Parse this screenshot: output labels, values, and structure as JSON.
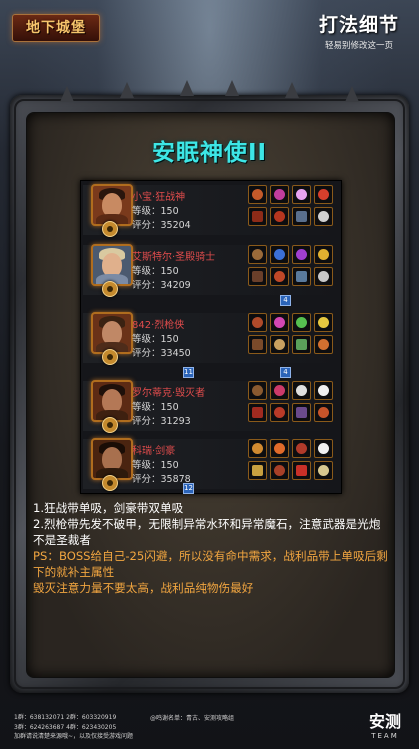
{
  "header": {
    "logo_text": "地下城堡",
    "title": "打法细节",
    "subtitle": "轻易别修改这一页"
  },
  "boss_title": "安眠神使II",
  "team": [
    {
      "name": "小宝·狂战神",
      "level": "等级：150",
      "score": "评分：35204",
      "portrait": "berserker-portrait"
    },
    {
      "name": "艾斯特尔·圣殿骑士",
      "level": "等级：150",
      "score": "评分：34209",
      "portrait": "templar-knight-portrait"
    },
    {
      "name": "842·烈枪侠",
      "level": "等级：150",
      "score": "评分：33450",
      "portrait": "gunslinger-portrait"
    },
    {
      "name": "罗尔蒂克·毁灭者",
      "level": "等级：150",
      "score": "评分：31293",
      "portrait": "destroyer-portrait"
    },
    {
      "name": "科瑞·剑豪",
      "level": "等级：150",
      "score": "评分：35878",
      "portrait": "sword-master-portrait"
    }
  ],
  "badges": {
    "row2": "4",
    "row3a": "11",
    "row3b": "4",
    "row5": "12"
  },
  "notes": [
    {
      "text": "1.狂战带单吸，剑豪带双单吸",
      "color": "white"
    },
    {
      "text": "2.烈枪带先发不破甲，无限制异常水环和异常魔石，注意武器是光炮不是圣裁者",
      "color": "white"
    },
    {
      "text": "PS：BOSS给自己-25闪避，所以没有命中需求，战利品带上单吸后剩下的就补主属性",
      "color": "orange"
    },
    {
      "text": "毁灭注意力量不要太高，战利品纯物伤最好",
      "color": "orange"
    }
  ],
  "footer": {
    "qq_lines": [
      "1群：638132071   2群：603320919",
      "3群：624263687   4群：623430205"
    ],
    "notice": "加群请说清楚来源哦~，以及仅接受游戏问题",
    "credit": "@鸣谢名单：青古、安测攻略组",
    "brand": "安测",
    "brand_sub": "TEAM"
  },
  "colors": {
    "title_cyan": "#3de6e6",
    "name_red": "#e04c4c",
    "note_orange": "#f2a640",
    "slot_border": "#8a5a1a"
  }
}
